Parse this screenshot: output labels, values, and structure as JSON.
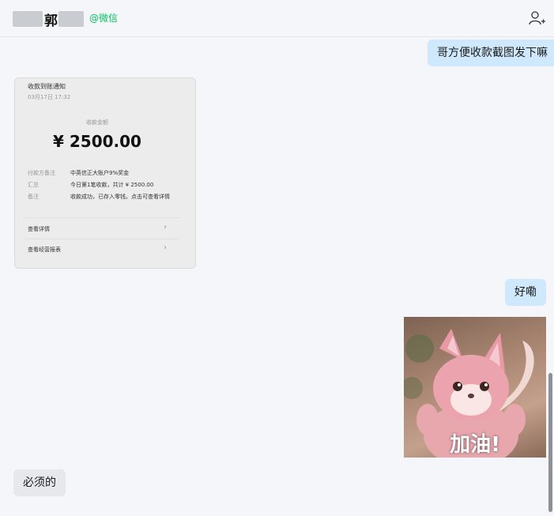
{
  "header": {
    "name": "郭",
    "source_tag": "@微信",
    "source_color": "#07c160"
  },
  "messages": {
    "m1": "哥方便收款截图发下嘛",
    "m2": "好嘞",
    "m3": "必须的"
  },
  "receipt_card": {
    "title": "收款到账通知",
    "time": "03月17日 17:32",
    "amount_label": "收款金额",
    "amount": "¥ 2500.00",
    "rows": [
      {
        "key": "付款方备注",
        "value": "中英信正大账户9%奖金"
      },
      {
        "key": "汇总",
        "value": "今日第1笔收款，共计 ¥ 2500.00"
      },
      {
        "key": "备注",
        "value": "收款成功，已存入零钱。点击可查看详情"
      }
    ],
    "links": [
      "查看详情",
      "查看经营报表"
    ]
  },
  "sticker": {
    "caption": "加油!"
  },
  "icons": {
    "add_contact": "add-contact-icon",
    "chevron": "chevron-right-icon"
  }
}
